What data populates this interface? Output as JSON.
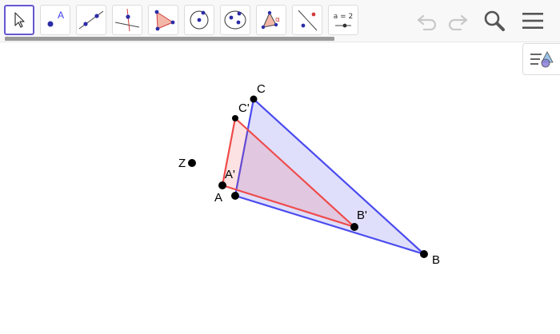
{
  "toolbar": {
    "tools": [
      {
        "name": "move-tool",
        "active": true
      },
      {
        "name": "point-tool",
        "label": "A"
      },
      {
        "name": "line-tool"
      },
      {
        "name": "perpendicular-line-tool"
      },
      {
        "name": "polygon-tool"
      },
      {
        "name": "circle-with-center-tool"
      },
      {
        "name": "ellipse-tool"
      },
      {
        "name": "angle-tool",
        "label": "α"
      },
      {
        "name": "reflect-about-line-tool"
      },
      {
        "name": "slider-tool",
        "label": "a = 2"
      }
    ],
    "undo_enabled": false,
    "redo_enabled": false,
    "icons": [
      "undo-icon",
      "redo-icon",
      "search-icon",
      "menu-icon",
      "style-bar-icon"
    ]
  },
  "colors": {
    "accent": "#6557d2",
    "triangle_blue": "#4b4bef",
    "triangle_blue_fill": "#dcdcfb",
    "triangle_red": "#ef4b4b",
    "triangle_red_fill": "#e8c4dc",
    "point": "#000000",
    "disabled_icon": "#c8c8c8",
    "icon": "#555555"
  },
  "geometry": {
    "points": {
      "A": "A",
      "B": "B",
      "C": "C",
      "A_prime": "A'",
      "B_prime": "B'",
      "C_prime": "C'",
      "Z": "Z"
    }
  }
}
